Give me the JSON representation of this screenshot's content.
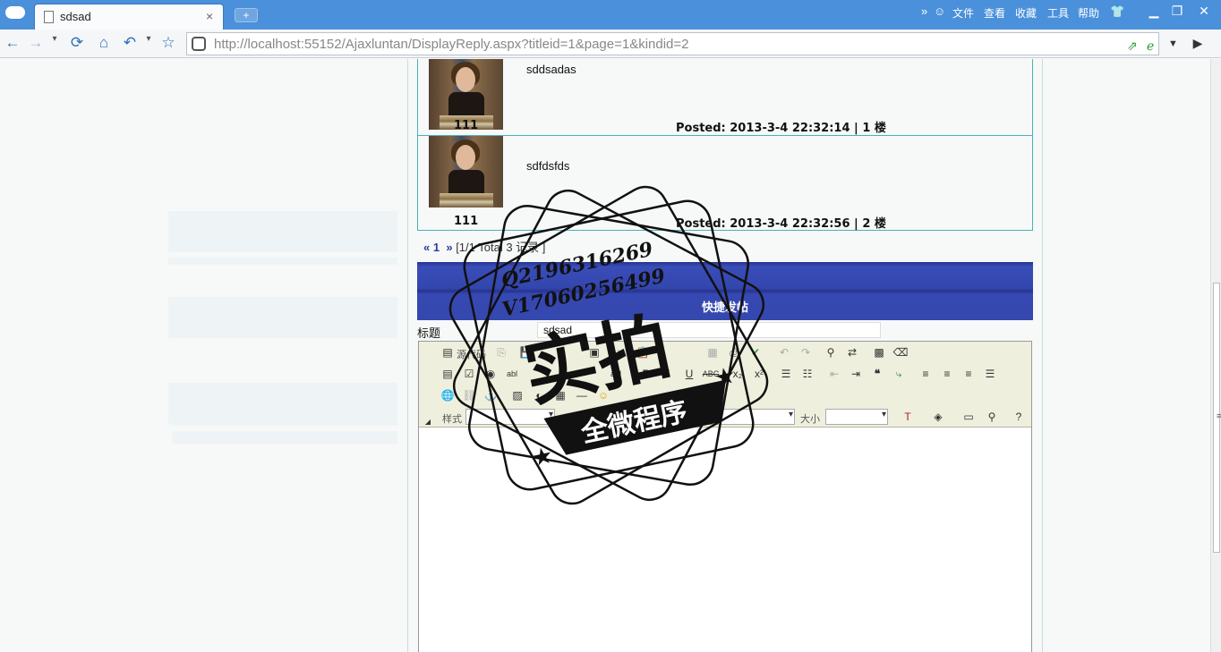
{
  "browser": {
    "tab_title": "sdsad",
    "tab_close": "×",
    "new_tab": "+",
    "menu": {
      "file": "文件",
      "view": "查看",
      "favorites": "收藏",
      "tools": "工具",
      "help": "帮助"
    },
    "url_host": "http://localhost",
    "url_rest": ":55152/Ajaxluntan/DisplayReply.aspx?titleid=1&page=1&kindid=2"
  },
  "replies": [
    {
      "user": "111",
      "content": "sddsadas",
      "posted": "Posted: 2013-3-4 22:32:14 | 1 楼"
    },
    {
      "user": "111",
      "content": "sdfdsfds",
      "posted": "Posted: 2013-3-4 22:32:56 | 2 楼"
    }
  ],
  "pager": {
    "prev": "«",
    "current": "1",
    "next": "»",
    "summary": "[1/1 Total 3 记录 ]"
  },
  "quick_post": {
    "header": "快捷发帖",
    "title_label": "标题",
    "title_value": "sdsad"
  },
  "editor": {
    "source_label": "源代码",
    "style_label": "样式",
    "size_label": "大小"
  },
  "watermark": {
    "line1": "Q2196316269",
    "line2": "V17060256499",
    "big": "实拍",
    "banner": "全微程序"
  },
  "colors": {
    "titlebar": "#4a90db",
    "quickbar": "#3346ad",
    "reply_border": "#4ab2b8"
  }
}
